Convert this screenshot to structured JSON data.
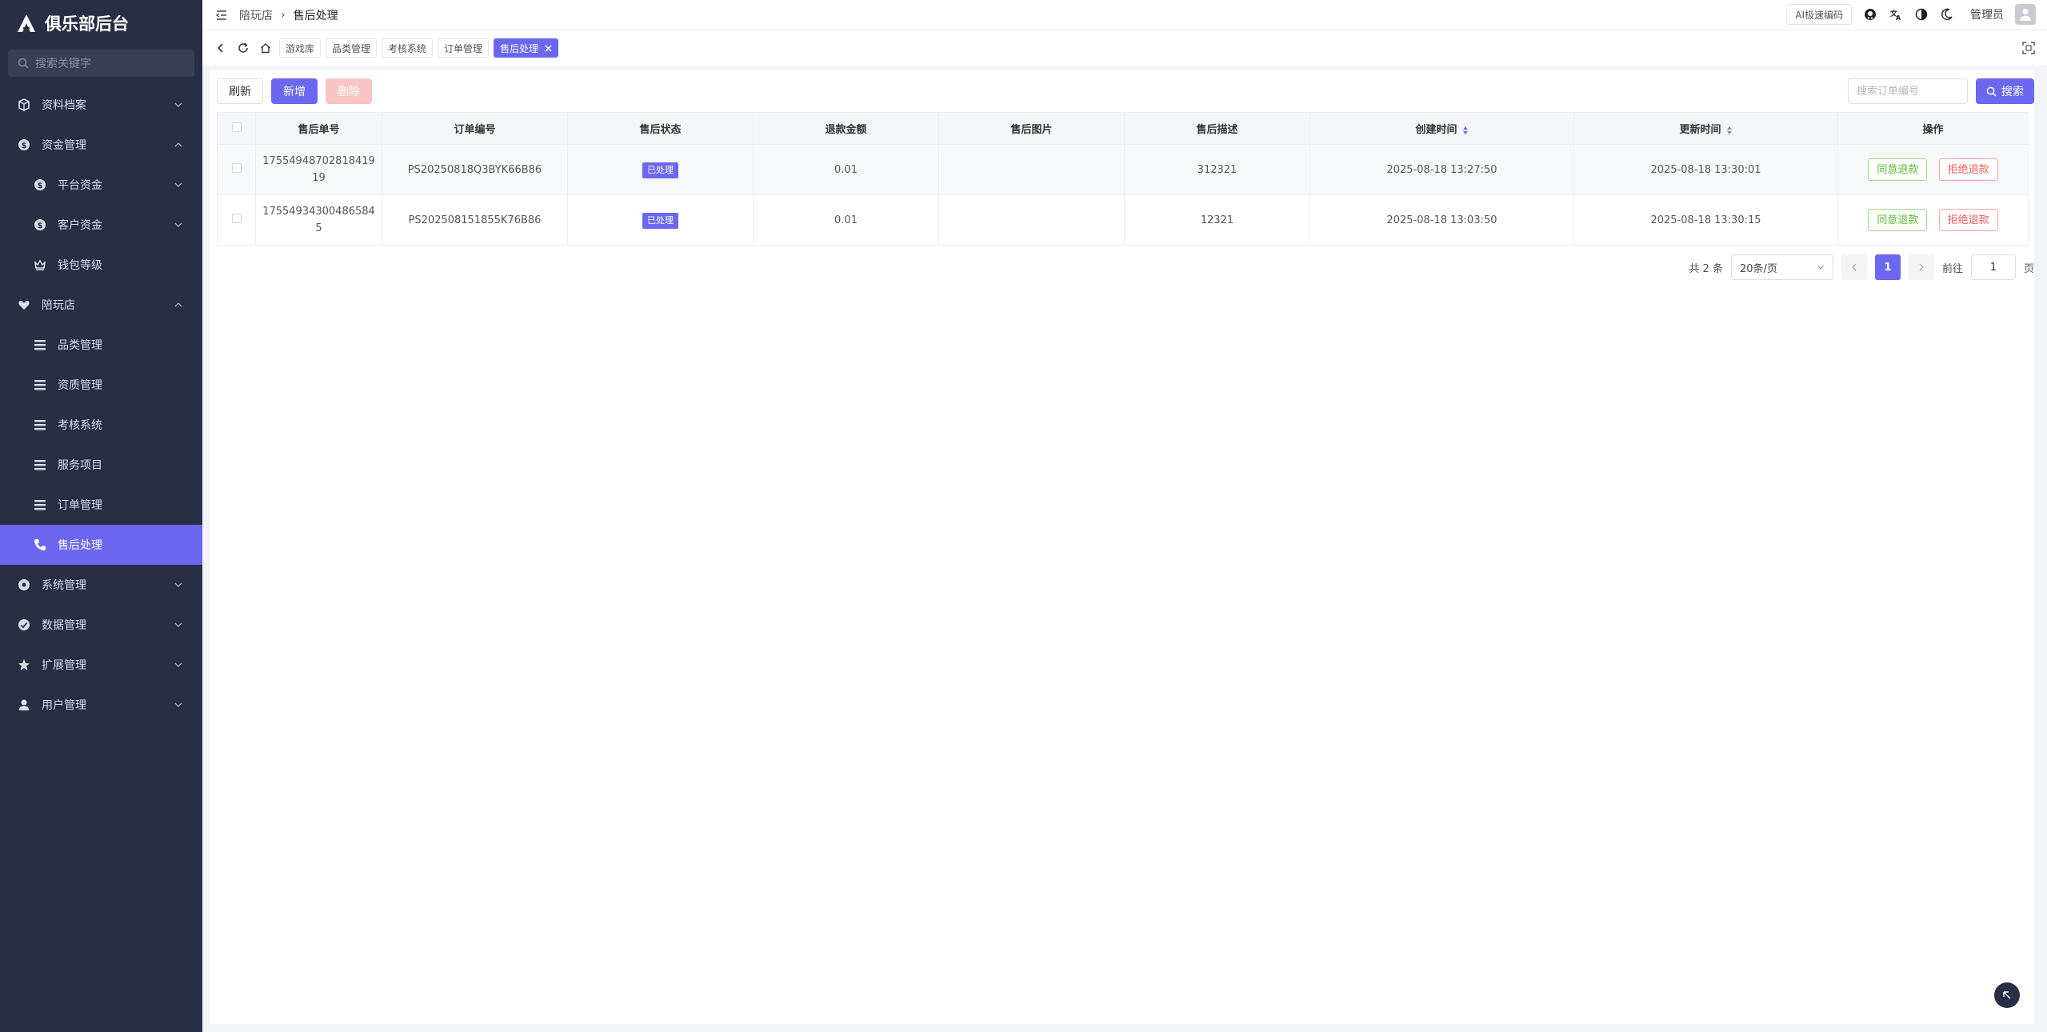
{
  "app": {
    "title": "俱乐部后台"
  },
  "sidebar": {
    "search_placeholder": "搜索关键字",
    "items": [
      {
        "label": "资料档案",
        "icon": "box-icon",
        "level": 1,
        "expanded": false
      },
      {
        "label": "资金管理",
        "icon": "dollar-icon",
        "level": 1,
        "expanded": true
      },
      {
        "label": "平台资金",
        "icon": "dollar-icon",
        "level": 2,
        "expanded": false
      },
      {
        "label": "客户资金",
        "icon": "dollar-icon",
        "level": 2,
        "expanded": false
      },
      {
        "label": "钱包等级",
        "icon": "crown-icon",
        "level": 2
      },
      {
        "label": "陪玩店",
        "icon": "heart-hand-icon",
        "level": 1,
        "expanded": true
      },
      {
        "label": "品类管理",
        "icon": "list-icon",
        "level": 2
      },
      {
        "label": "资质管理",
        "icon": "list-icon",
        "level": 2
      },
      {
        "label": "考核系统",
        "icon": "list-icon",
        "level": 2
      },
      {
        "label": "服务项目",
        "icon": "list-icon",
        "level": 2
      },
      {
        "label": "订单管理",
        "icon": "list-icon",
        "level": 2
      },
      {
        "label": "售后处理",
        "icon": "phone-icon",
        "level": 2,
        "active": true
      },
      {
        "label": "系统管理",
        "icon": "gear-icon",
        "level": 1,
        "expanded": false
      },
      {
        "label": "数据管理",
        "icon": "check-circle-icon",
        "level": 1,
        "expanded": false
      },
      {
        "label": "扩展管理",
        "icon": "star-icon",
        "level": 1,
        "expanded": false
      },
      {
        "label": "用户管理",
        "icon": "user-icon",
        "level": 1,
        "expanded": false
      }
    ]
  },
  "header": {
    "breadcrumb": [
      "陪玩店",
      "售后处理"
    ],
    "ai_button": "AI极速编码",
    "user_name": "管理员"
  },
  "tabs": [
    {
      "label": "游戏库"
    },
    {
      "label": "品类管理"
    },
    {
      "label": "考核系统"
    },
    {
      "label": "订单管理"
    },
    {
      "label": "售后处理",
      "active": true
    }
  ],
  "toolbar": {
    "refresh": "刷新",
    "add": "新增",
    "delete": "删除",
    "search_placeholder": "搜索订单编号",
    "search_button": "搜索"
  },
  "table": {
    "columns": [
      "售后单号",
      "订单编号",
      "售后状态",
      "退款金额",
      "售后图片",
      "售后描述",
      "创建时间",
      "更新时间",
      "操作"
    ],
    "rows": [
      {
        "id_line1": "17554948702818419",
        "id_line2": "19",
        "order_no": "PS20250818Q3BYK66B86",
        "status": "已处理",
        "amount": "0.01",
        "image": "",
        "desc": "312321",
        "created": "2025-08-18 13:27:50",
        "updated": "2025-08-18 13:30:01",
        "agree": "同意退款",
        "reject": "拒绝退款"
      },
      {
        "id_line1": "17554934300486584",
        "id_line2": "5",
        "order_no": "PS202508151855K76B86",
        "status": "已处理",
        "amount": "0.01",
        "image": "",
        "desc": "12321",
        "created": "2025-08-18 13:03:50",
        "updated": "2025-08-18 13:30:15",
        "agree": "同意退款",
        "reject": "拒绝退款"
      }
    ]
  },
  "pagination": {
    "total": "共 2 条",
    "page_size": "20条/页",
    "current": "1",
    "goto_label": "前往",
    "goto_value": "1",
    "page_suffix": "页"
  },
  "colors": {
    "primary": "#6b67f0",
    "sidebar_bg": "#2a2e45",
    "success": "#5cb83a",
    "danger": "#ef5d5d"
  }
}
